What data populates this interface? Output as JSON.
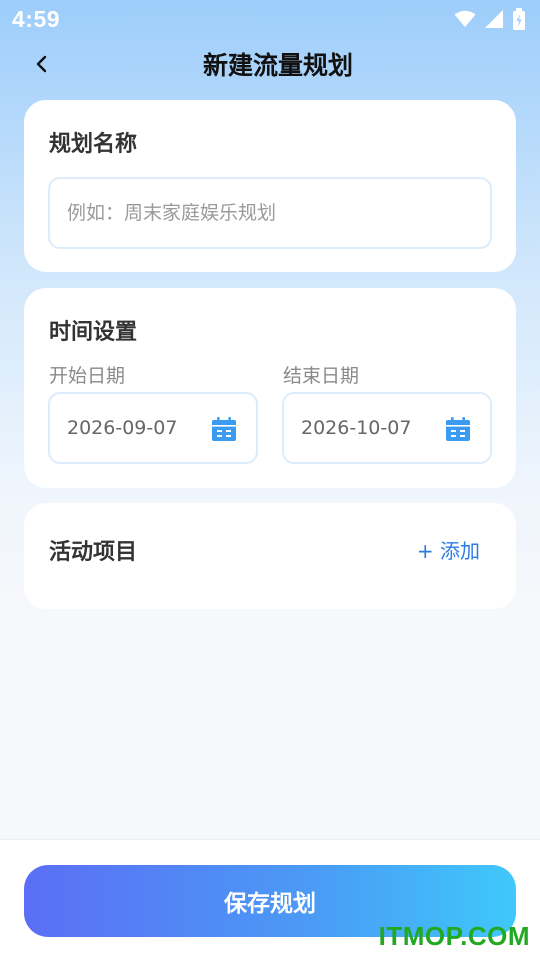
{
  "status": {
    "time": "4:59"
  },
  "nav": {
    "title": "新建流量规划"
  },
  "plan_name": {
    "title": "规划名称",
    "placeholder": "例如：周末家庭娱乐规划",
    "value": ""
  },
  "time_settings": {
    "title": "时间设置",
    "start_label": "开始日期",
    "start_value": "2026-09-07",
    "end_label": "结束日期",
    "end_value": "2026-10-07"
  },
  "activities": {
    "title": "活动项目",
    "add_label": "+ 添加"
  },
  "footer": {
    "save_label": "保存规划"
  },
  "watermark": "ITMOP.COM",
  "colors": {
    "accent": "#2c7be5",
    "calendar_icon": "#3a9bf0",
    "save_gradient_start": "#5b6ef5",
    "save_gradient_end": "#3fc8fb",
    "watermark": "#23a821"
  },
  "icons": {
    "back": "chevron-left-icon",
    "wifi": "wifi-icon",
    "signal": "signal-icon",
    "battery": "battery-charging-icon",
    "calendar": "calendar-icon"
  }
}
